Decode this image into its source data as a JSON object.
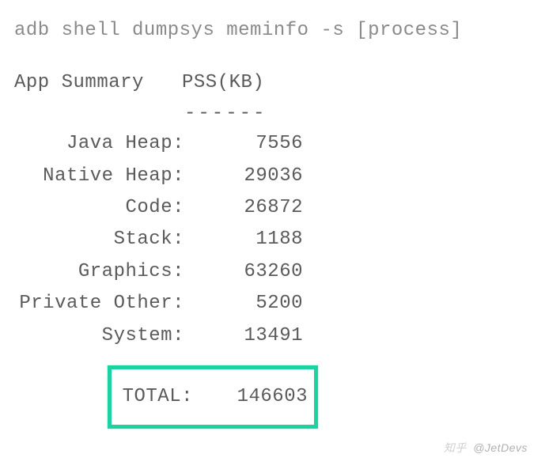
{
  "command": "adb shell dumpsys meminfo -s [process]",
  "header": {
    "label": "App Summary",
    "value": "PSS(KB)"
  },
  "divider": "------",
  "rows": [
    {
      "label": "Java Heap:",
      "value": "7556"
    },
    {
      "label": "Native Heap:",
      "value": "29036"
    },
    {
      "label": "Code:",
      "value": "26872"
    },
    {
      "label": "Stack:",
      "value": "1188"
    },
    {
      "label": "Graphics:",
      "value": "63260"
    },
    {
      "label": "Private Other:",
      "value": "5200"
    },
    {
      "label": "System:",
      "value": "13491"
    }
  ],
  "total": {
    "label": "TOTAL:",
    "value": "146603"
  },
  "watermark": {
    "prefix": "知乎",
    "text": "@JetDevs"
  }
}
